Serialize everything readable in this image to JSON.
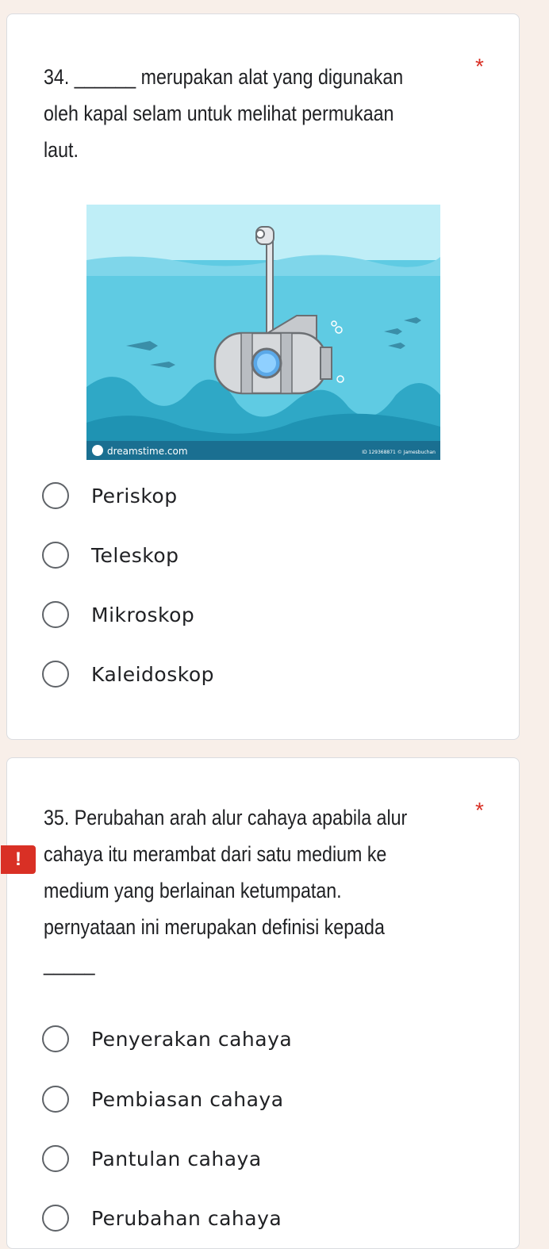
{
  "questions": [
    {
      "number_text": "34. ______ merupakan alat yang digunakan",
      "line2": "oleh kapal selam untuk melihat permukaan",
      "line3": "laut.",
      "required_mark": "*",
      "image": {
        "watermark_left": "dreamstime.com",
        "watermark_right": "ID 129368871 © Jamesbuchan"
      },
      "options": [
        "Periskop",
        "Teleskop",
        "Mikroskop",
        "Kaleidoskop"
      ]
    },
    {
      "line1": "35. Perubahan arah alur cahaya apabila alur",
      "line2": "cahaya itu merambat dari satu medium ke",
      "line3": "medium yang berlainan ketumpatan.",
      "line4": "pernyataan ini merupakan definisi kepada",
      "line5": "_____",
      "required_mark": "*",
      "warning_icon": "!",
      "options": [
        "Penyerakan cahaya",
        "Pembiasan cahaya",
        "Pantulan cahaya",
        "Perubahan cahaya"
      ]
    }
  ],
  "colors": {
    "page_bg": "#f8efe9",
    "card_bg": "#ffffff",
    "required": "#d93025",
    "water": "#4fc3dc",
    "deep_water": "#2fa8c6",
    "sky": "#bfeef7"
  }
}
